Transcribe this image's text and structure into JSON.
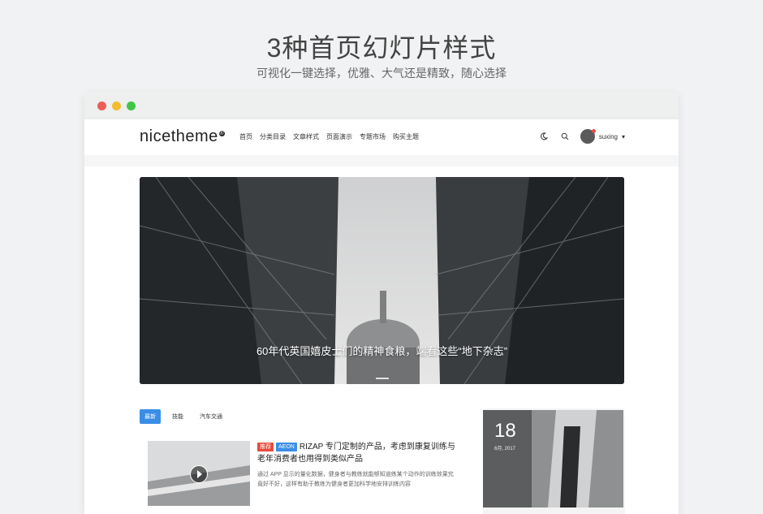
{
  "promo": {
    "title": "3种首页幻灯片样式",
    "subtitle": "可视化一键选择，优雅、大气还是精致，随心选择"
  },
  "site": {
    "logo": "nicetheme",
    "logo_mark": "®",
    "nav": [
      "首页",
      "分类目录",
      "文章样式",
      "页面演示",
      "专题市场",
      "购买主题"
    ],
    "user": {
      "name": "suxing",
      "caret": "▾"
    }
  },
  "slider": {
    "caption": "60年代英国嬉皮士们的精神食粮，端看这些“地下杂志”"
  },
  "tabs": [
    "最新",
    "技能",
    "汽车交通"
  ],
  "article": {
    "tags": [
      "推荐",
      "AEON"
    ],
    "title": "RIZAP 专门定制的产品，考虑到康复训练与老年消费者也用得到类似产品",
    "desc": "通过 APP 显示的量化数据，健身者与教练就能够知道练某个动作的训练效果究竟好不好，这样有助于教练为健身者更加科学地安排训练内容"
  },
  "side": {
    "day": "18",
    "month": "6月, 2017"
  },
  "colors": {
    "accent": "#3a8ee6",
    "tag_red": "#e74c3c"
  }
}
